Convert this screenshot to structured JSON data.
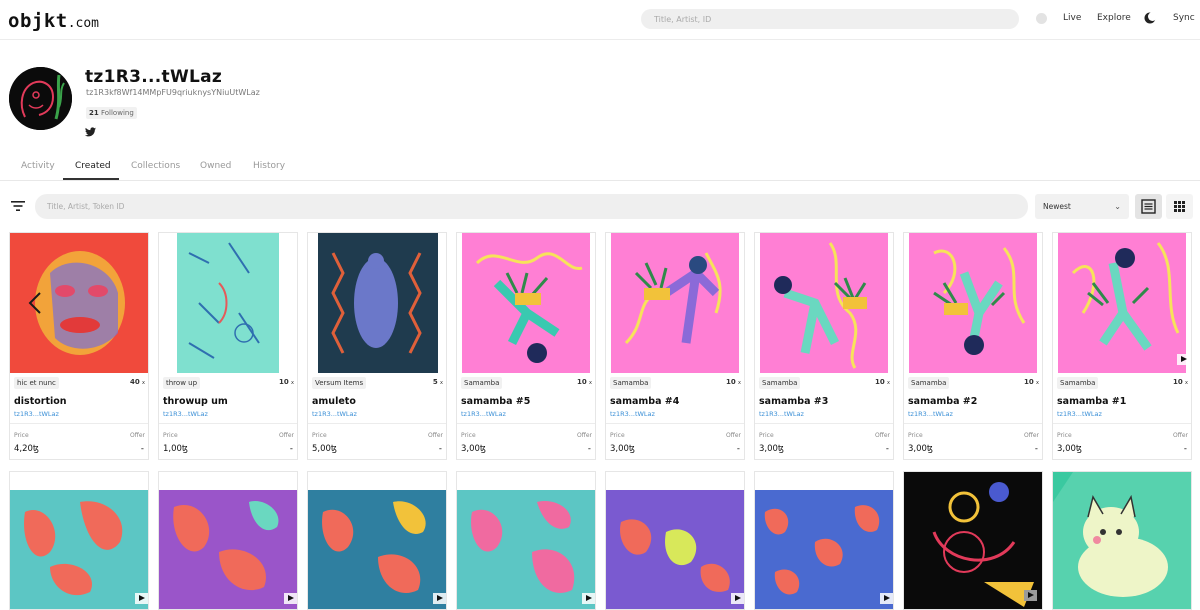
{
  "header": {
    "logo_main": "objkt",
    "logo_suffix": ".com",
    "search_placeholder": "Title, Artist, ID",
    "nav": [
      "Live",
      "Explore",
      "Sync"
    ]
  },
  "profile": {
    "alias": "tz1R3...tWLaz",
    "address": "tz1R3kf8Wf14MMpFU9qriuknysYNiuUtWLaz",
    "following_count": "21",
    "following_label": "Following"
  },
  "tabs": [
    "Activity",
    "Created",
    "Collections",
    "Owned",
    "History"
  ],
  "active_tab": "Created",
  "toolbar": {
    "search_placeholder": "Title, Artist, Token ID",
    "sort_value": "Newest"
  },
  "tokens": [
    {
      "collection": "hic et nunc",
      "editions": "40",
      "title": "distortion",
      "creator": "tz1R3...tWLaz",
      "price_label": "Price",
      "offer_label": "Offer",
      "price": "4,20ꜩ",
      "offer": "-",
      "video": false
    },
    {
      "collection": "throw up",
      "editions": "10",
      "title": "throwup um",
      "creator": "tz1R3...tWLaz",
      "price_label": "Price",
      "offer_label": "Offer",
      "price": "1,00ꜩ",
      "offer": "-",
      "video": false
    },
    {
      "collection": "Versum Items",
      "editions": "5",
      "title": "amuleto",
      "creator": "tz1R3...tWLaz",
      "price_label": "Price",
      "offer_label": "Offer",
      "price": "5,00ꜩ",
      "offer": "-",
      "video": false
    },
    {
      "collection": "Samamba",
      "editions": "10",
      "title": "samamba #5",
      "creator": "tz1R3...tWLaz",
      "price_label": "Price",
      "offer_label": "Offer",
      "price": "3,00ꜩ",
      "offer": "-",
      "video": false
    },
    {
      "collection": "Samamba",
      "editions": "10",
      "title": "samamba #4",
      "creator": "tz1R3...tWLaz",
      "price_label": "Price",
      "offer_label": "Offer",
      "price": "3,00ꜩ",
      "offer": "-",
      "video": false
    },
    {
      "collection": "Samamba",
      "editions": "10",
      "title": "samamba #3",
      "creator": "tz1R3...tWLaz",
      "price_label": "Price",
      "offer_label": "Offer",
      "price": "3,00ꜩ",
      "offer": "-",
      "video": false
    },
    {
      "collection": "Samamba",
      "editions": "10",
      "title": "samamba #2",
      "creator": "tz1R3...tWLaz",
      "price_label": "Price",
      "offer_label": "Offer",
      "price": "3,00ꜩ",
      "offer": "-",
      "video": false
    },
    {
      "collection": "Samamba",
      "editions": "10",
      "title": "samamba #1",
      "creator": "tz1R3...tWLaz",
      "price_label": "Price",
      "offer_label": "Offer",
      "price": "3,00ꜩ",
      "offer": "-",
      "video": true
    }
  ],
  "colors": {
    "link": "#3a8fd6",
    "pink_art": "#ff7fd4",
    "teal_art": "#7fe0cf",
    "red_art": "#f04a3c",
    "navy_art": "#1f3b4e"
  }
}
